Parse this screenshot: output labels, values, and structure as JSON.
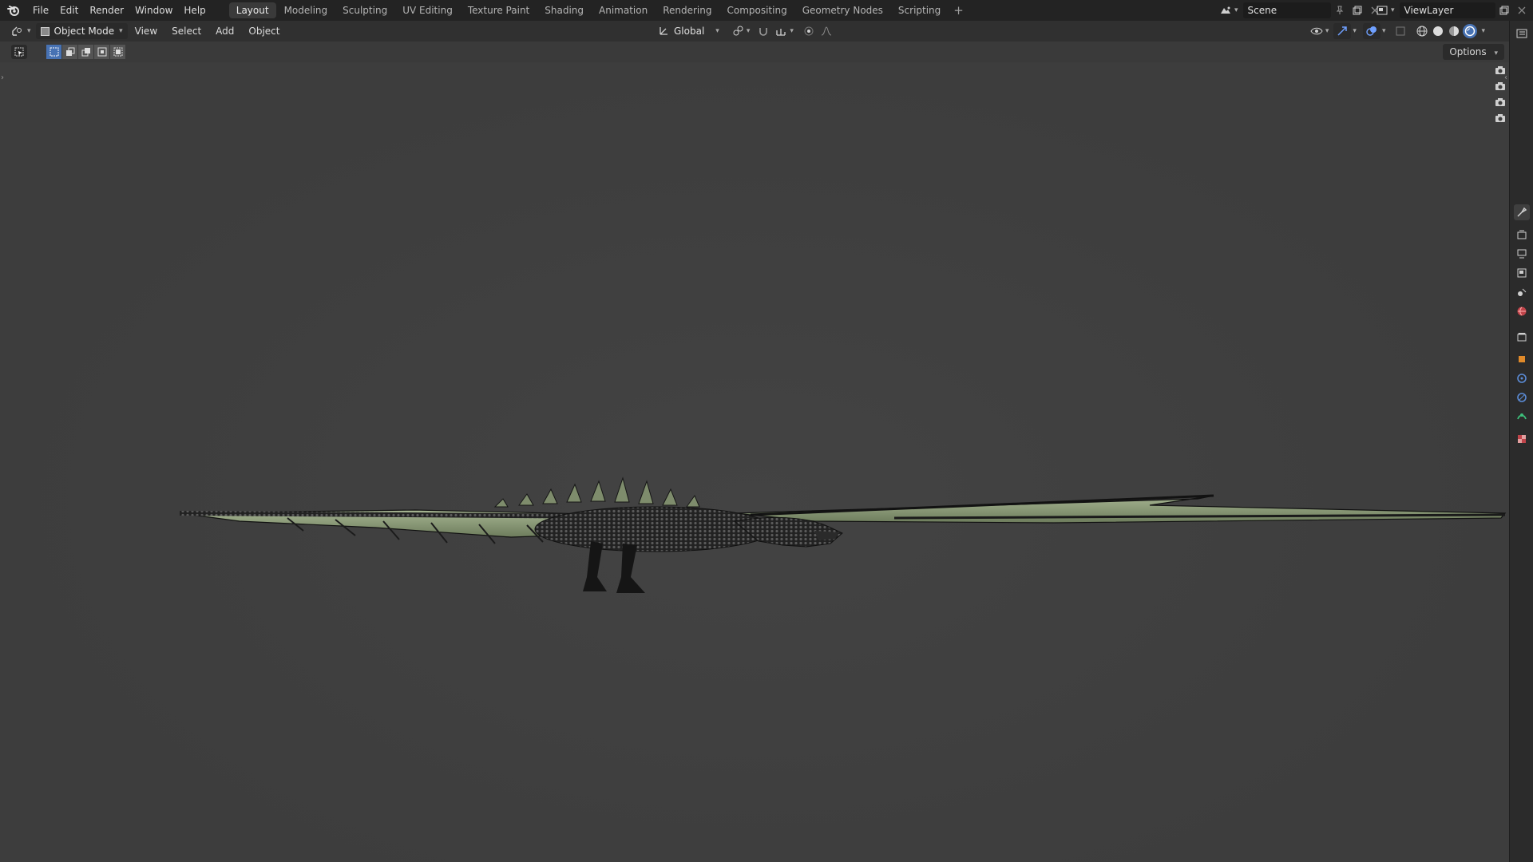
{
  "menus": {
    "file": "File",
    "edit": "Edit",
    "render": "Render",
    "window": "Window",
    "help": "Help"
  },
  "workspaces": [
    {
      "label": "Layout",
      "active": true
    },
    {
      "label": "Modeling"
    },
    {
      "label": "Sculpting"
    },
    {
      "label": "UV Editing"
    },
    {
      "label": "Texture Paint"
    },
    {
      "label": "Shading"
    },
    {
      "label": "Animation"
    },
    {
      "label": "Rendering"
    },
    {
      "label": "Compositing"
    },
    {
      "label": "Geometry Nodes"
    },
    {
      "label": "Scripting"
    }
  ],
  "workspace_add": "+",
  "scene": {
    "name": "Scene"
  },
  "view_layer": {
    "name": "ViewLayer"
  },
  "viewport_header": {
    "mode": "Object Mode",
    "menu_view": "View",
    "menu_select": "Select",
    "menu_add": "Add",
    "menu_object": "Object",
    "orientation": "Global"
  },
  "tool_settings": {
    "options": "Options"
  },
  "colors": {
    "accent": "#4772b3",
    "topbar": "#232323",
    "header": "#303030",
    "viewport": "#3d3d3d",
    "dragon_scale": "#8fa07a"
  },
  "icons": {
    "logo": "blender-logo-icon",
    "shading": [
      "wireframe-icon",
      "solid-icon",
      "material-preview-icon",
      "rendered-icon"
    ]
  }
}
